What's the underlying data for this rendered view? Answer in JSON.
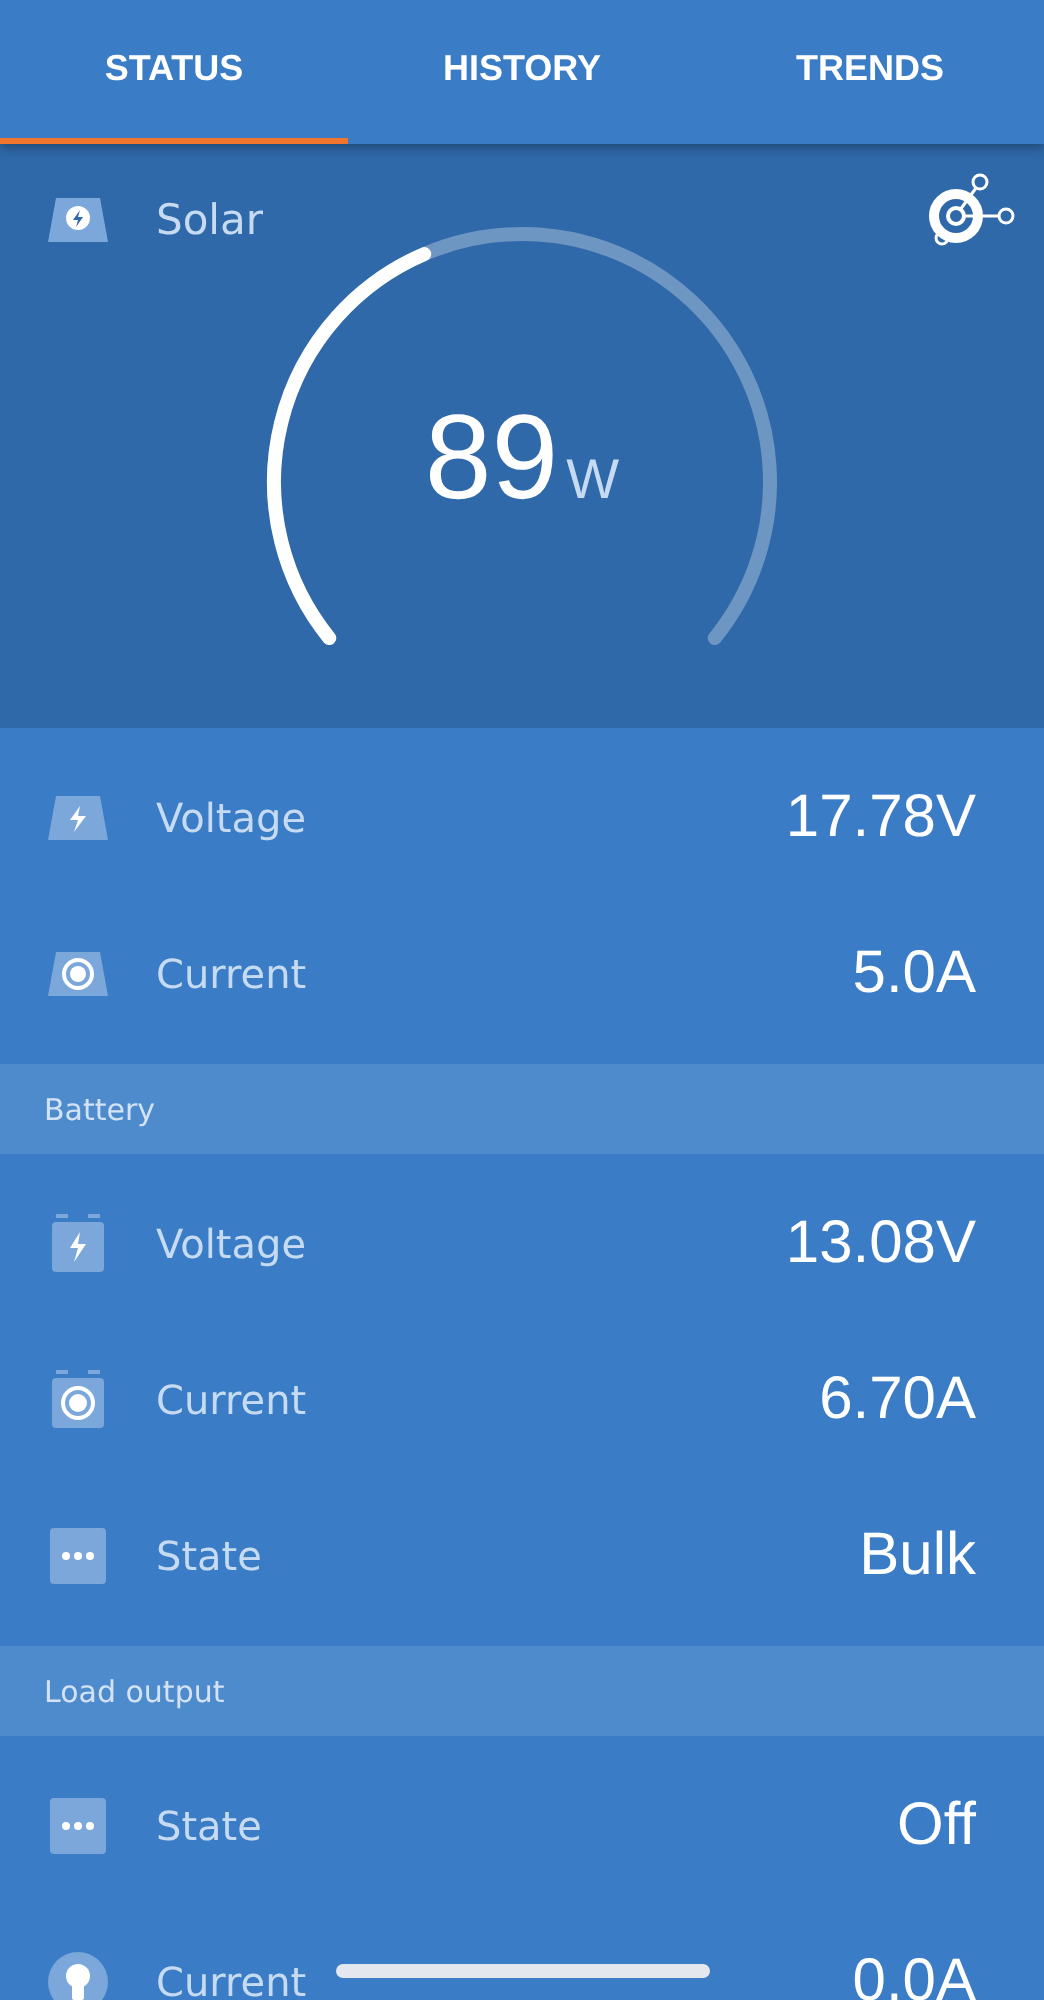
{
  "tabs": [
    {
      "label": "STATUS",
      "selected": true
    },
    {
      "label": "HISTORY",
      "selected": false
    },
    {
      "label": "TRENDS",
      "selected": false
    }
  ],
  "solar": {
    "title": "Solar",
    "gauge": {
      "value": "89",
      "unit": "W"
    }
  },
  "solar_readings": [
    {
      "kind": "panel-bolt",
      "label": "Voltage",
      "value": "17.78V"
    },
    {
      "kind": "panel-target",
      "label": "Current",
      "value": "5.0A"
    }
  ],
  "sections": [
    {
      "title": "Battery",
      "rows": [
        {
          "kind": "battery-bolt",
          "label": "Voltage",
          "value": "13.08V"
        },
        {
          "kind": "battery-target",
          "label": "Current",
          "value": "6.70A"
        },
        {
          "kind": "dots",
          "label": "State",
          "value": "Bulk"
        }
      ]
    },
    {
      "title": "Load output",
      "rows": [
        {
          "kind": "dots",
          "label": "State",
          "value": "Off"
        },
        {
          "kind": "bulb",
          "label": "Current",
          "value": "0.0A"
        }
      ]
    }
  ]
}
